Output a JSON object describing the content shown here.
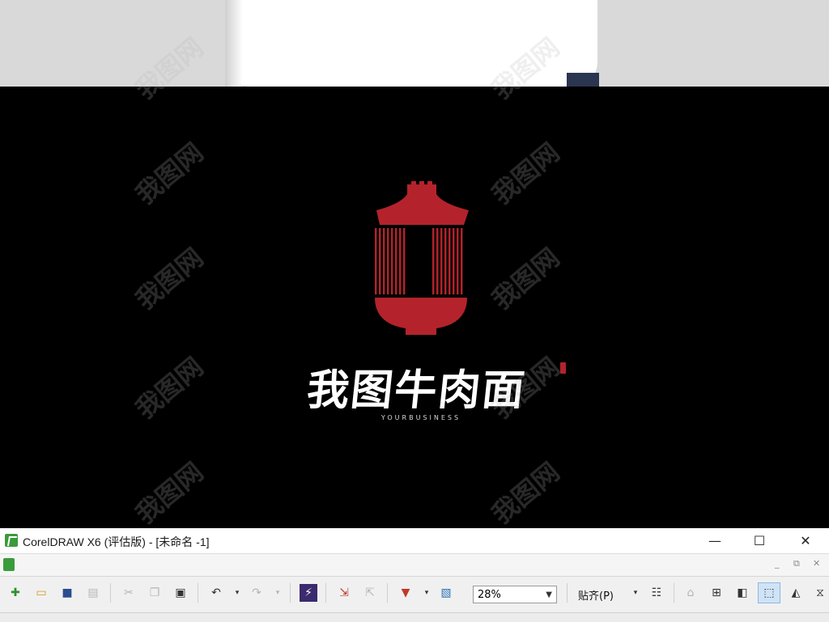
{
  "window": {
    "title": "CorelDRAW X6 (评估版) - [未命名 -1]",
    "minimize_label": "—",
    "maximize_label": "☐",
    "close_label": "✕"
  },
  "document": {
    "minimize_label": "_",
    "restore_label": "⧉",
    "close_label": "✕"
  },
  "toolbar": {
    "zoom_value": "28%",
    "snap_label": "贴齐(P)",
    "icons": [
      "new-icon",
      "open-icon",
      "save-icon",
      "print-icon",
      "cut-icon",
      "copy-icon",
      "paste-icon",
      "undo-icon",
      "redo-icon",
      "search-content-icon",
      "import-icon",
      "export-icon",
      "publish-pdf-icon",
      "app-launcher-icon",
      "options-icon",
      "welcome-icon",
      "settings-icon",
      "transform-icon",
      "bounding-icon",
      "chart-icon"
    ]
  },
  "canvas": {
    "brand_name": "我图牛肉面",
    "tagline": "YOURBUSINESS",
    "accent_color": "#b4232b",
    "watermark_text": "我图网"
  }
}
